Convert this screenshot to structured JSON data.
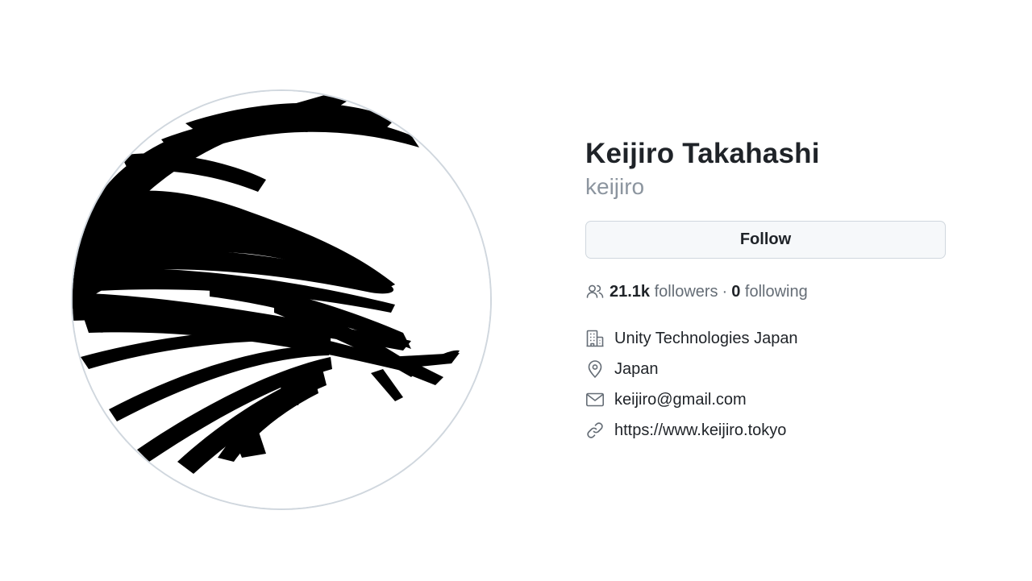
{
  "profile": {
    "full_name": "Keijiro Takahashi",
    "username": "keijiro",
    "avatar_alt": "Avatar"
  },
  "follow_button": {
    "label": "Follow"
  },
  "stats": {
    "icon": "people-icon",
    "followers_count": "21.1k",
    "followers_label": "followers",
    "separator": "·",
    "following_count": "0",
    "following_label": "following"
  },
  "details": {
    "organization": {
      "icon": "organization-icon",
      "text": "Unity Technologies Japan"
    },
    "location": {
      "icon": "location-icon",
      "text": "Japan"
    },
    "email": {
      "icon": "mail-icon",
      "text": "keijiro@gmail.com"
    },
    "website": {
      "icon": "link-icon",
      "text": "https://www.keijiro.tokyo"
    }
  },
  "colors": {
    "text_primary": "#1f2328",
    "text_muted": "#656d76",
    "username": "#8c959f",
    "button_bg": "#f6f8fa",
    "button_border": "#d0d7de"
  }
}
